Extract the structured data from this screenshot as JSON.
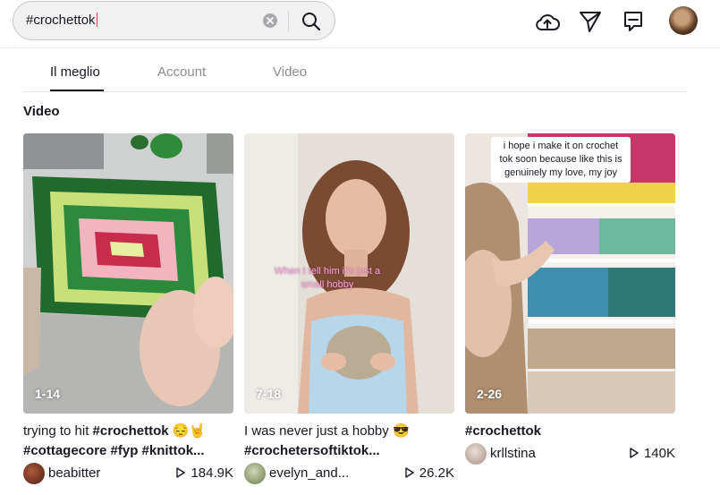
{
  "search": {
    "value": "#crochettok",
    "placeholder": ""
  },
  "tabs": [
    {
      "label": "Il meglio",
      "active": true
    },
    {
      "label": "Account",
      "active": false
    },
    {
      "label": "Video",
      "active": false
    }
  ],
  "section_title": "Video",
  "videos": [
    {
      "tag": "1-14",
      "caption_prefix": "trying to hit ",
      "caption_bold1": "#crochettok",
      "caption_emoji": " 😔🤘",
      "caption_line2": "#cottagecore #fyp #knittok...",
      "username": "beabitter",
      "views": "184.9K",
      "avatar_color": "#7a3d2a"
    },
    {
      "tag": "7-18",
      "caption_prefix": "I was never just a hobby ",
      "caption_bold1": "",
      "caption_emoji": "😎",
      "caption_line2": "#crochetersoftiktok...",
      "username": "evelyn_and...",
      "views": "26.2K",
      "overlay_text": "When I tell him it's just a small hobby",
      "avatar_color": "#7c8a5c"
    },
    {
      "tag": "2-26",
      "caption_prefix": "",
      "caption_bold1": "#crochettok",
      "caption_emoji": "",
      "caption_line2": "",
      "username": "krllstina",
      "views": "140K",
      "overlay_text": "i hope i make it on crochet tok soon because like this is genuinely my love, my joy",
      "avatar_color": "#c8b6a8"
    }
  ],
  "colors": {
    "accent": "#fe2c55",
    "text": "#161823",
    "muted": "#8a8b91"
  },
  "icons": [
    "search-icon",
    "clear-icon",
    "upload-icon",
    "send-icon",
    "inbox-icon",
    "play-icon"
  ]
}
